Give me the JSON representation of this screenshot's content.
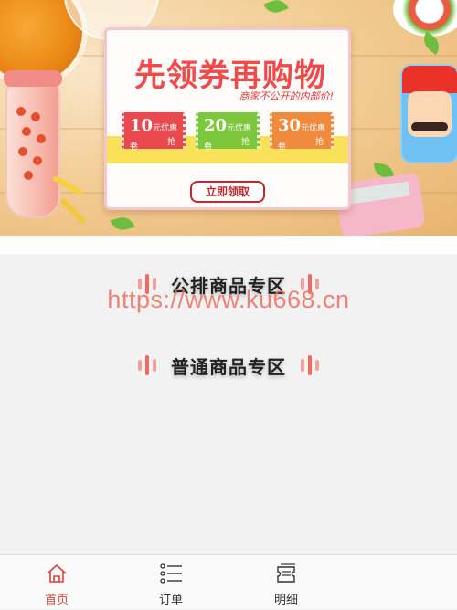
{
  "banner": {
    "title": "先领券再购物",
    "subtitle": "商家不公开的内部价!",
    "coupons": [
      {
        "amount": "10",
        "unit": "元优惠卷",
        "grab": "抢",
        "color": "#e84a4f"
      },
      {
        "amount": "20",
        "unit": "元优惠卷",
        "grab": "抢",
        "color": "#7cc73b"
      },
      {
        "amount": "30",
        "unit": "元优惠卷",
        "grab": "抢",
        "color": "#f08a3c"
      }
    ],
    "claim_button": "立即领取"
  },
  "zones": [
    {
      "label": "公排商品专区"
    },
    {
      "label": "普通商品专区"
    }
  ],
  "watermark": "https://www.ku668.cn",
  "tabbar": {
    "items": [
      {
        "label": "首页",
        "icon": "home-icon",
        "active": true
      },
      {
        "label": "订单",
        "icon": "list-icon",
        "active": false
      },
      {
        "label": "明细",
        "icon": "ticket-icon",
        "active": false
      }
    ],
    "active_color": "#d9423a"
  }
}
